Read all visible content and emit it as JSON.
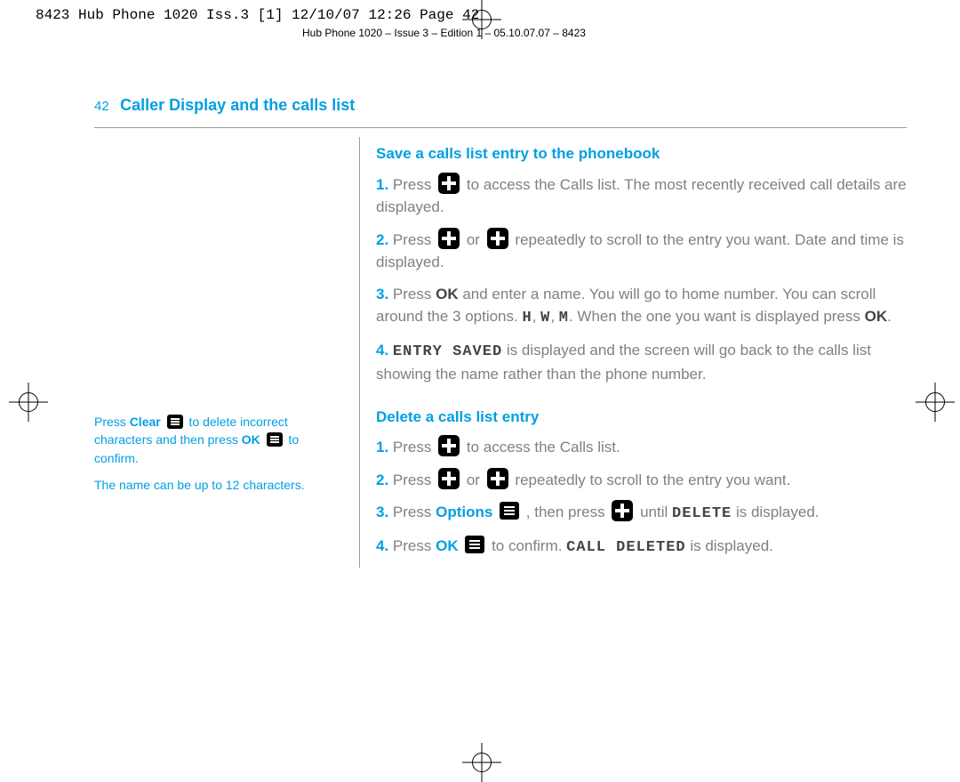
{
  "header": {
    "crop": "8423 Hub Phone 1020 Iss.3 [1]  12/10/07  12:26  Page 42",
    "sub": "Hub Phone 1020 – Issue 3 – Edition 1 – 05.10.07.07 – 8423"
  },
  "page": {
    "num": "42",
    "title": "Caller Display and the calls list"
  },
  "side": {
    "p1a": "Press ",
    "p1b": "Clear",
    "p1c": " to delete incorrect characters and then press ",
    "p1d": "OK",
    "p1e": " to confirm.",
    "p2": "The name can be up to 12 characters."
  },
  "sA": {
    "title": "Save a calls list entry to the phonebook",
    "s1a": "Press ",
    "s1b": " to access the Calls list. The most recently received call details are displayed.",
    "s2a": "Press ",
    "s2b": " or ",
    "s2c": " repeatedly to scroll to the entry you want. Date and time is displayed.",
    "s3a": "Press ",
    "s3b": "OK",
    "s3c": " and enter a name. You will go to home number. You can scroll around the 3 options. ",
    "s3d": "H",
    "s3e": ", ",
    "s3f": "W",
    "s3g": ", ",
    "s3h": "M",
    "s3i": ". When the one you want is displayed press ",
    "s3j": "OK",
    "s3k": ".",
    "s4a": "ENTRY SAVED",
    "s4b": " is displayed and the screen will go back to the calls list showing the name rather than the phone number."
  },
  "sB": {
    "title": "Delete a calls list entry",
    "s1a": "Press ",
    "s1b": " to access the Calls list.",
    "s2a": "Press ",
    "s2b": " or ",
    "s2c": " repeatedly to scroll to the entry you want.",
    "s3a": "Press ",
    "s3b": "Options",
    "s3c": " , then press ",
    "s3d": " until ",
    "s3e": "DELETE",
    "s3f": " is displayed.",
    "s4a": "Press ",
    "s4b": "OK",
    "s4c": " to confirm. ",
    "s4d": "CALL DELETED",
    "s4e": " is displayed."
  },
  "nums": {
    "n1": "1.",
    "n2": "2.",
    "n3": "3.",
    "n4": "4."
  }
}
